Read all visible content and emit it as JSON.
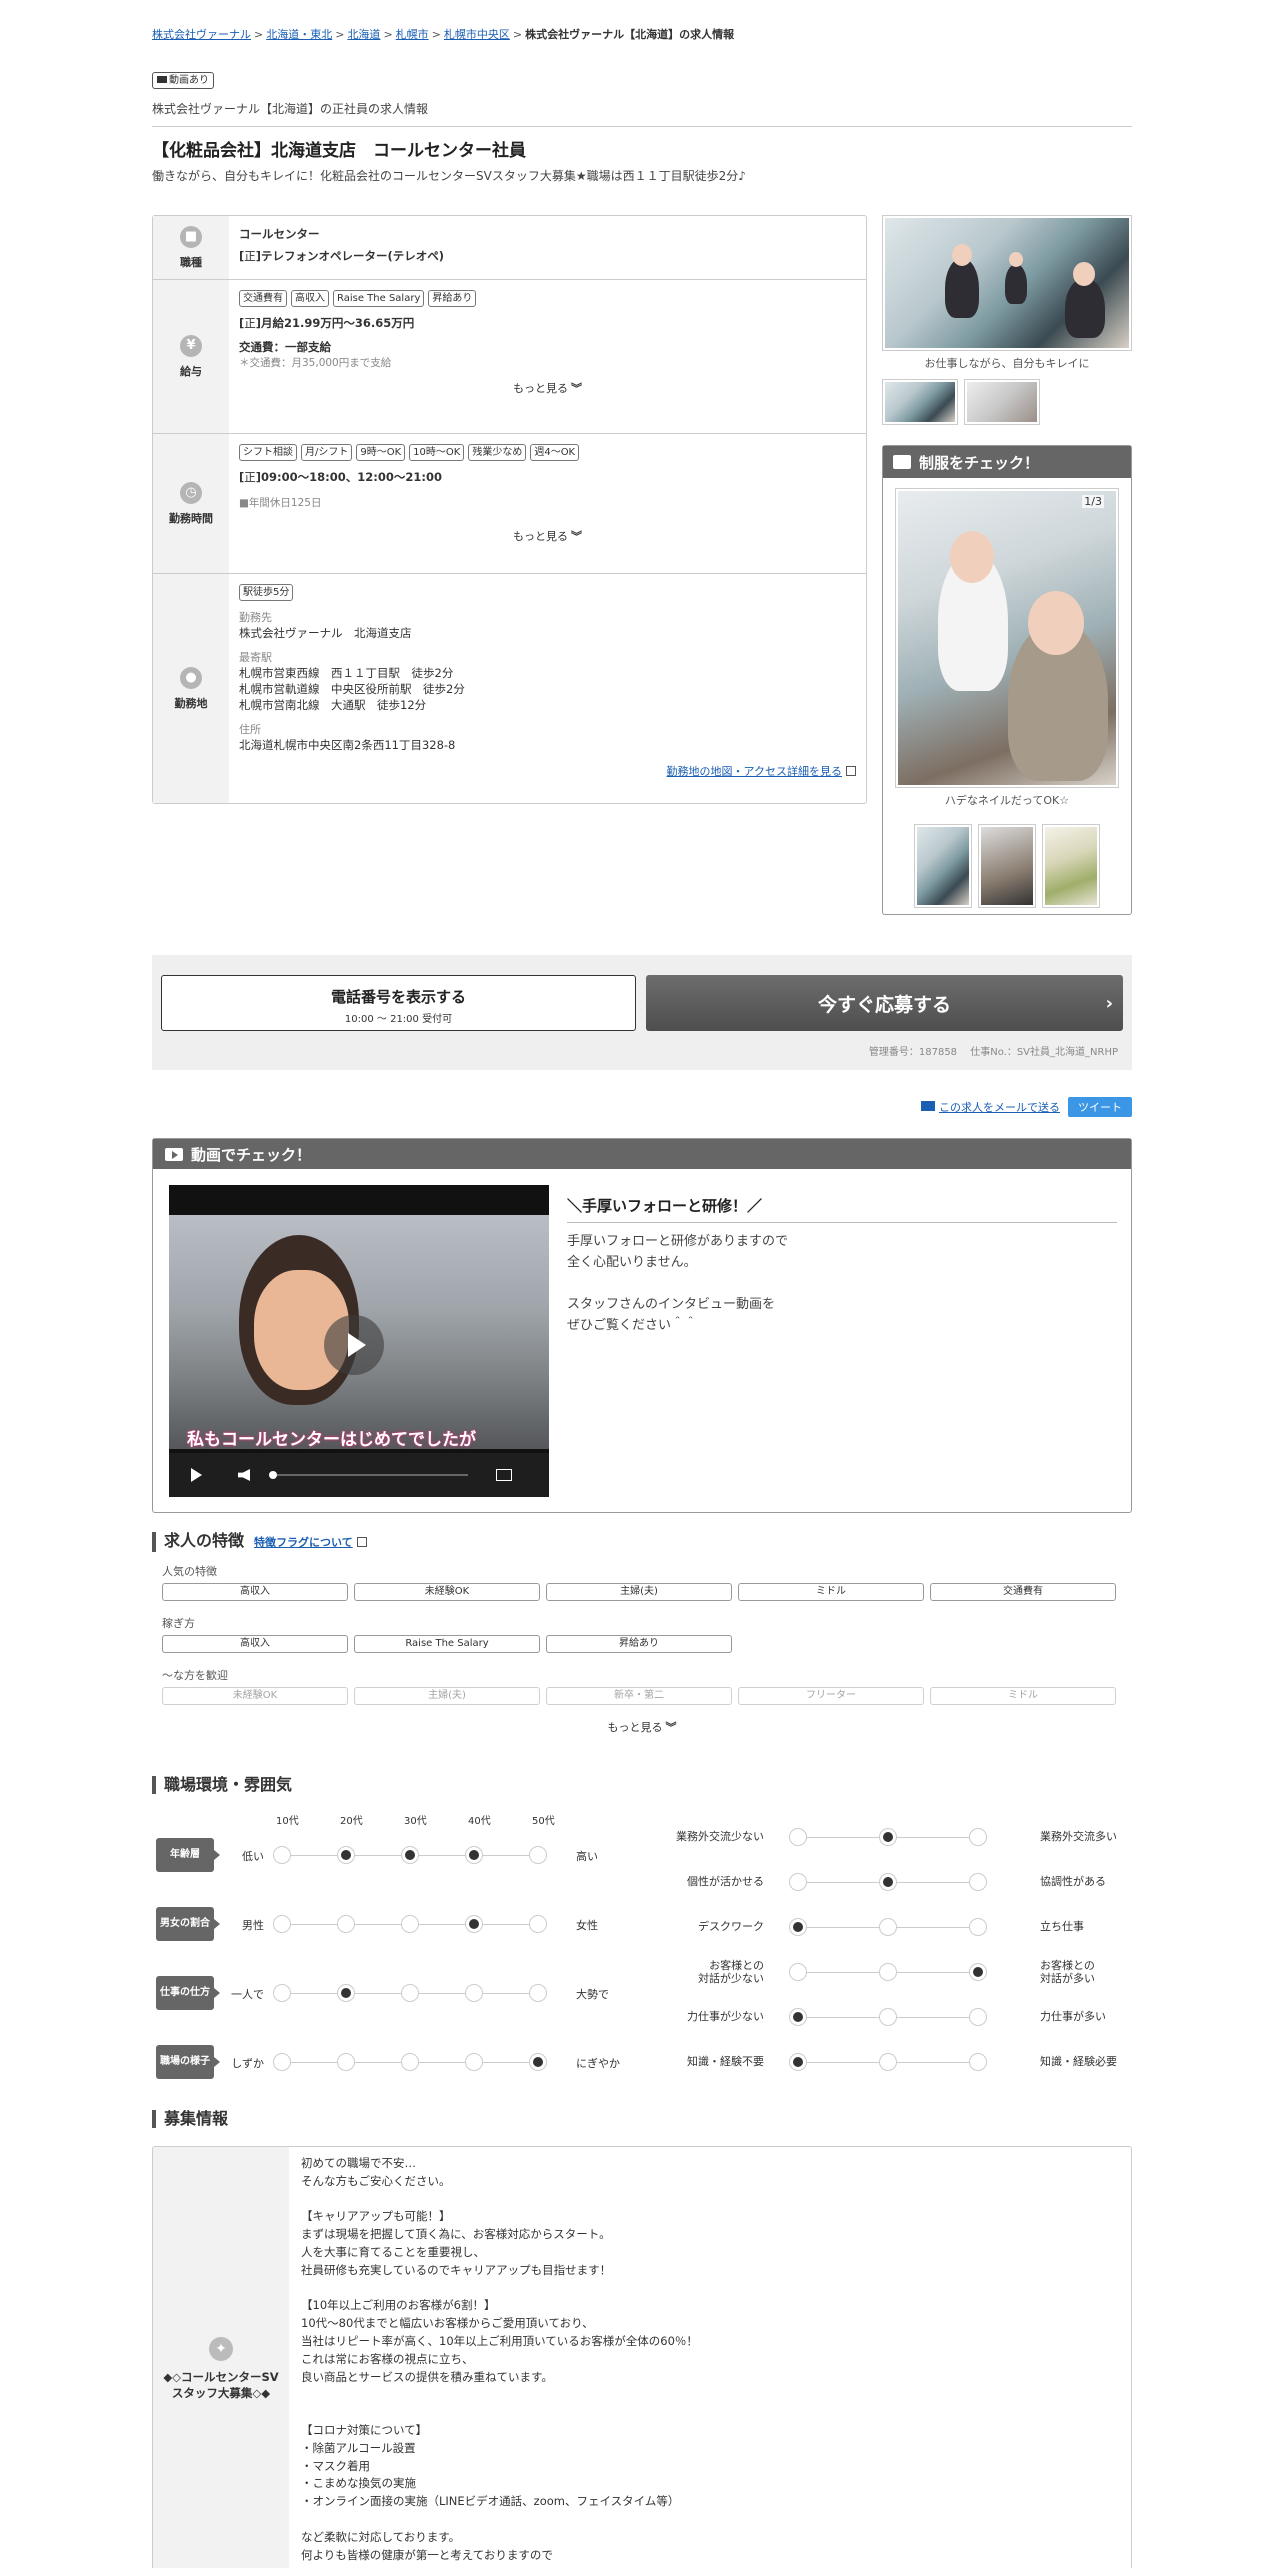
{
  "breadcrumb": [
    "株式会社ヴァーナル",
    "北海道・東北",
    "北海道",
    "札幌市",
    "札幌市中央区",
    "株式会社ヴァーナル【北海道】の求人情報"
  ],
  "movie_badge": "動画あり",
  "company_sub": "株式会社ヴァーナル【北海道】の正社員の求人情報",
  "job_title": "【化粧品会社】北海道支店　コールセンター社員",
  "job_catch": "働きながら、自分もキレイに！化粧品会社のコールセンターSVスタッフ大募集★職場は西１１丁目駅徒歩2分♪",
  "job_info": {
    "occupation": {
      "label": "職種",
      "category": "コールセンター",
      "type_badge": "正",
      "detail": "テレフォンオペレーター(テレオペ)"
    },
    "salary": {
      "label": "給与",
      "tags": [
        "交通費有",
        "高収入",
        "Raise The Salary",
        "昇給あり"
      ],
      "badge": "正",
      "amount": "月給21.99万円～36.65万円",
      "transport": "交通費：一部支給",
      "transport_note": "＊交通費：月35,000円まで支給",
      "more": "もっと見る"
    },
    "hours": {
      "label": "勤務時間",
      "tags": [
        "シフト相談",
        "月/シフト",
        "9時～OK",
        "10時～OK",
        "残業少なめ",
        "週4～OK"
      ],
      "badge": "正",
      "time": "09:00～18:00、12:00～21:00",
      "holiday": "■年間休日125日",
      "more": "もっと見る"
    },
    "location": {
      "label": "勤務地",
      "tags": [
        "駅徒歩5分"
      ],
      "workplace_label": "勤務先",
      "workplace": "株式会社ヴァーナル　北海道支店",
      "station_label": "最寄駅",
      "stations": [
        "札幌市営東西線　西１１丁目駅　徒歩2分",
        "札幌市営軌道線　中央区役所前駅　徒歩2分",
        "札幌市営南北線　大通駅　徒歩12分"
      ],
      "address_label": "住所",
      "address": "北海道札幌市中央区南2条西11丁目328-8",
      "map_link": "勤務地の地図・アクセス詳細を見る"
    }
  },
  "side_photo": {
    "caption": "お仕事しながら、自分もキレイに"
  },
  "uniform": {
    "title": "制服をチェック！",
    "counter": "1/3",
    "caption": "ハデなネイルだってOK☆"
  },
  "apply": {
    "tel_label": "電話番号を表示する",
    "tel_hours": "10:00 ～ 21:00 受付可",
    "apply_label": "今すぐ応募する",
    "management": "管理番号：187858　 仕事No.：SV社員_北海道_NRHP"
  },
  "share": {
    "mail": "この求人をメールで送る",
    "tweet": "ツイート"
  },
  "video": {
    "header": "動画でチェック！",
    "subtitle": "私もコールセンターはじめてでしたが",
    "title": "＼手厚いフォローと研修！／",
    "body": "手厚いフォローと研修がありますので\n全く心配いりません。\n\nスタッフさんのインタビュー動画を\nぜひご覧ください＾＾"
  },
  "features": {
    "title": "求人の特徴",
    "link": "特徴フラグについて",
    "groups": [
      {
        "name": "人気の特徴",
        "items": [
          "高収入",
          "未経験OK",
          "主婦(夫)",
          "ミドル",
          "交通費有"
        ]
      },
      {
        "name": "稼ぎ方",
        "items": [
          "高収入",
          "Raise The Salary",
          "昇給あり"
        ]
      },
      {
        "name": "～な方を歓迎",
        "items": [
          "未経験OK",
          "主婦(夫)",
          "新卒・第二",
          "フリーター",
          "ミドル"
        ]
      }
    ],
    "more": "もっと見る"
  },
  "environment": {
    "title": "職場環境・雰囲気",
    "age_labels": [
      "10代",
      "20代",
      "30代",
      "40代",
      "50代"
    ],
    "left": [
      {
        "name": "年齢層",
        "low": "低い",
        "high": "高い",
        "selected": [
          1,
          2,
          3
        ]
      },
      {
        "name": "男女の割合",
        "low": "男性",
        "high": "女性",
        "selected": [
          3
        ]
      },
      {
        "name": "仕事の仕方",
        "low": "一人で",
        "high": "大勢で",
        "selected": [
          1
        ]
      },
      {
        "name": "職場の様子",
        "low": "しずか",
        "high": "にぎやか",
        "selected": [
          4
        ]
      }
    ],
    "right": [
      {
        "low": "業務外交流少ない",
        "high": "業務外交流多い",
        "selected": 1
      },
      {
        "low": "個性が活かせる",
        "high": "協調性がある",
        "selected": 1
      },
      {
        "low": "デスクワーク",
        "high": "立ち仕事",
        "selected": 0
      },
      {
        "low": "お客様との\n対話が少ない",
        "high": "お客様との\n対話が多い",
        "selected": 2
      },
      {
        "low": "力仕事が少ない",
        "high": "力仕事が多い",
        "selected": 0
      },
      {
        "low": "知識・経験不要",
        "high": "知識・経験必要",
        "selected": 0
      }
    ]
  },
  "recruit": {
    "title": "募集情報",
    "side_title": "◆◇コールセンターSVスタッフ大募集◇◆",
    "body": "初めての職場で不安…\nそんな方もご安心ください。\n\n【キャリアアップも可能！】\nまずは現場を把握して頂く為に、お客様対応からスタート。\n人を大事に育てることを重要視し、\n社員研修も充実しているのでキャリアアップも目指せます！\n\n【10年以上ご利用のお客様が6割！】\n10代～80代までと幅広いお客様からご愛用頂いており、\n当社はリピート率が高く、10年以上ご利用頂いているお客様が全体の60％！\nこれは常にお客様の視点に立ち、\n良い商品とサービスの提供を積み重ねています。\n\n\n【コロナ対策について】\n・除菌アルコール設置\n・マスク着用\n・こまめな換気の実施\n・オンライン面接の実施（LINEビデオ通話、zoom、フェイスタイム等）\n\nなど柔軟に対応しております。\n何よりも皆様の健康が第一と考えておりますので"
  }
}
